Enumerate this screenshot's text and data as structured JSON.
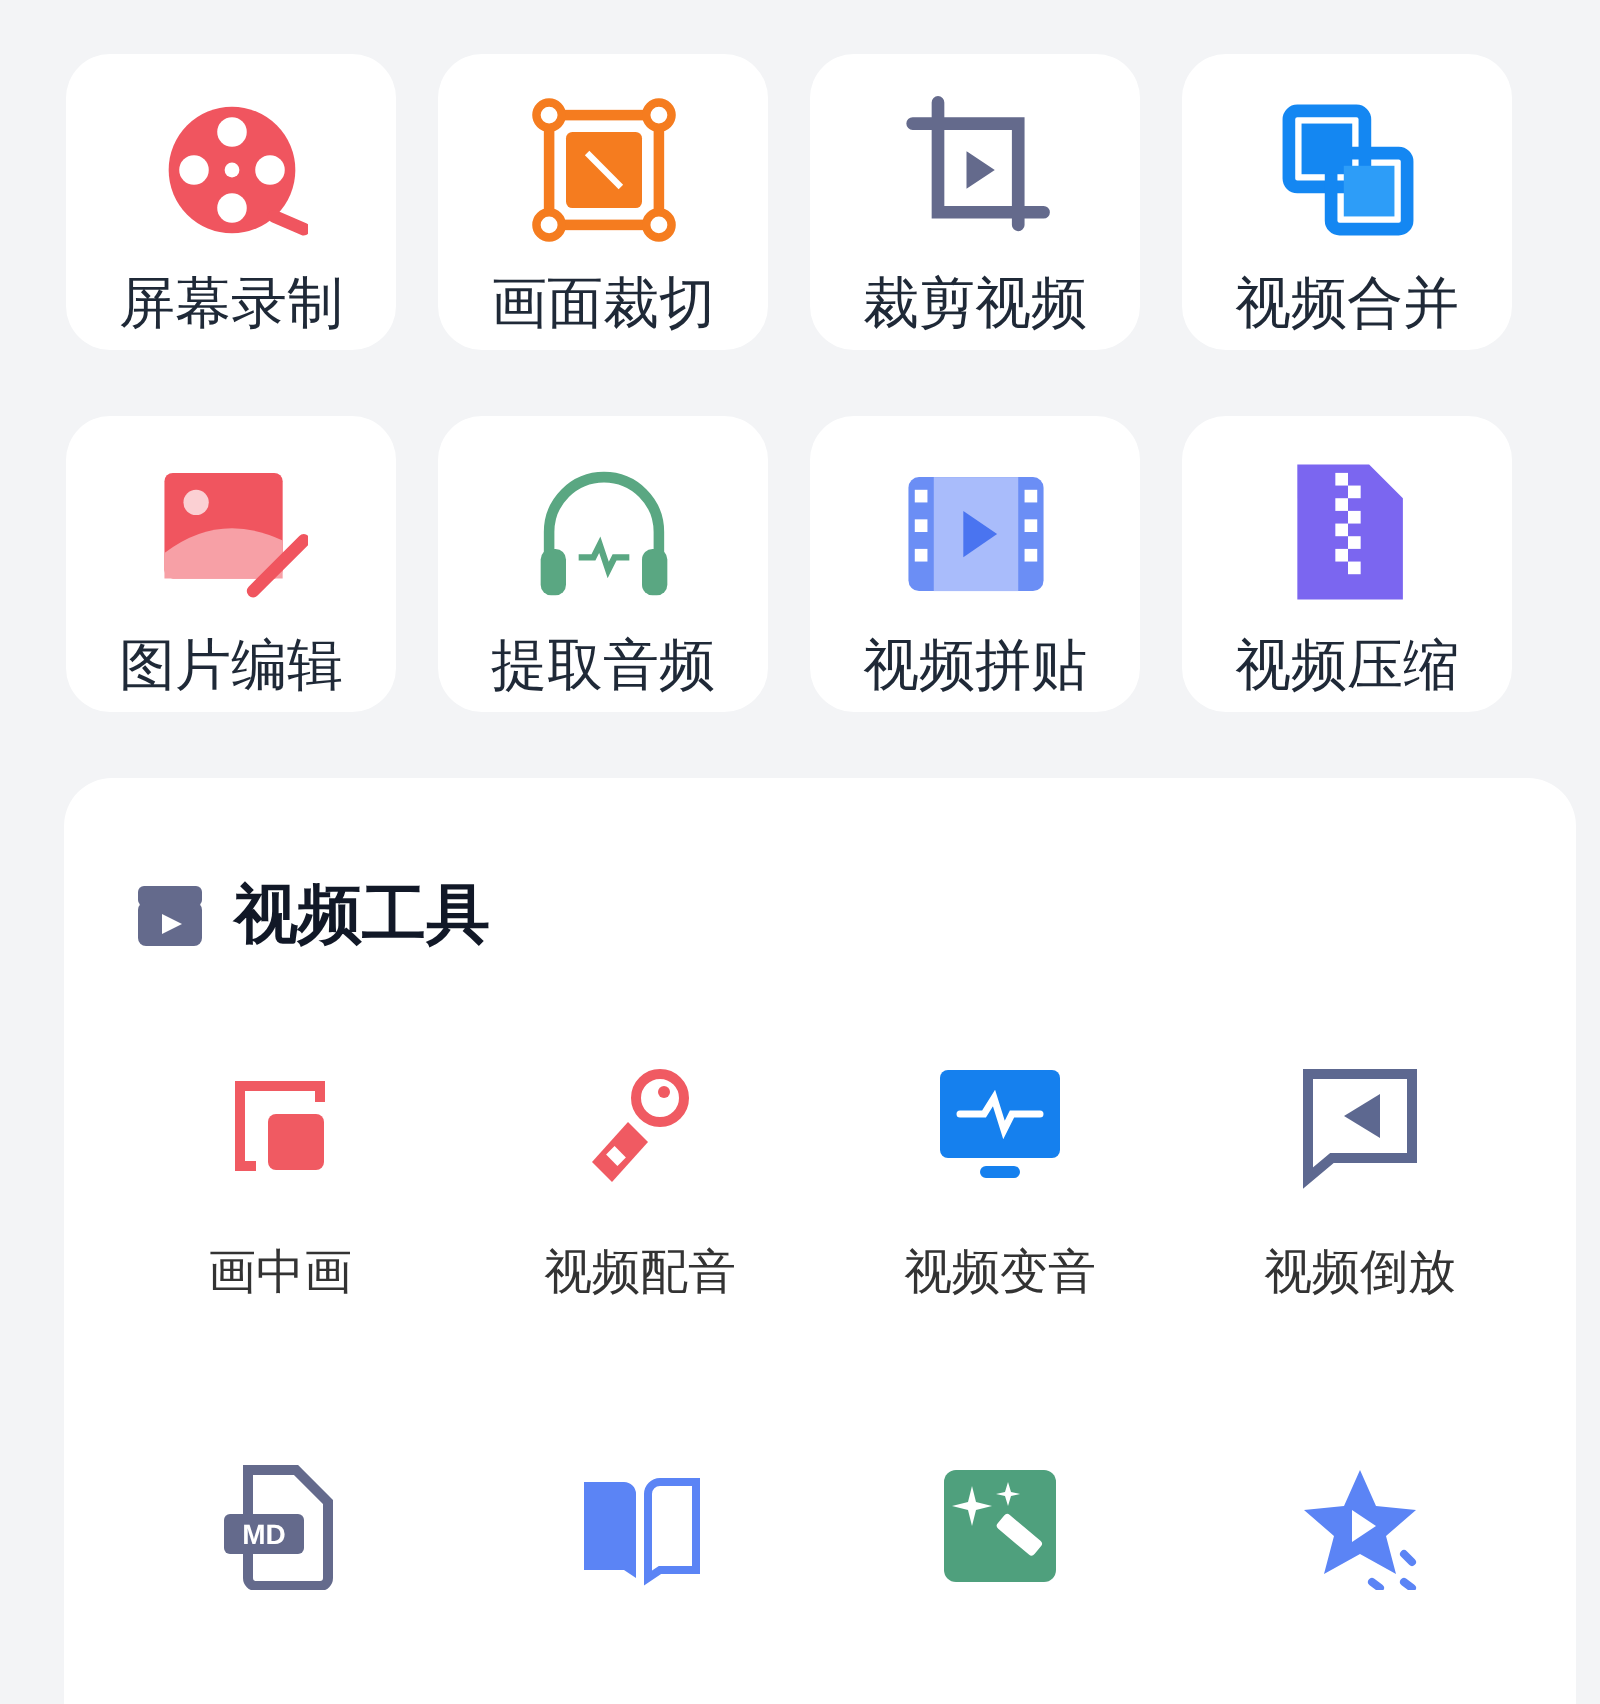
{
  "shortcuts": [
    {
      "label": "屏幕录制"
    },
    {
      "label": "画面裁切"
    },
    {
      "label": "裁剪视频"
    },
    {
      "label": "视频合并"
    },
    {
      "label": "图片编辑"
    },
    {
      "label": "提取音频"
    },
    {
      "label": "视频拼贴"
    },
    {
      "label": "视频压缩"
    }
  ],
  "video_tools": {
    "title": "视频工具",
    "items": [
      {
        "kind": "tool",
        "label": "画中画"
      },
      {
        "kind": "tool",
        "label": "视频配音"
      },
      {
        "kind": "tool",
        "label": "视频变音"
      },
      {
        "kind": "tool",
        "label": "视频倒放"
      },
      {
        "kind": "tool",
        "icon_text": "MD"
      },
      {
        "kind": "tool"
      },
      {
        "kind": "tool"
      },
      {
        "kind": "tool"
      }
    ]
  }
}
